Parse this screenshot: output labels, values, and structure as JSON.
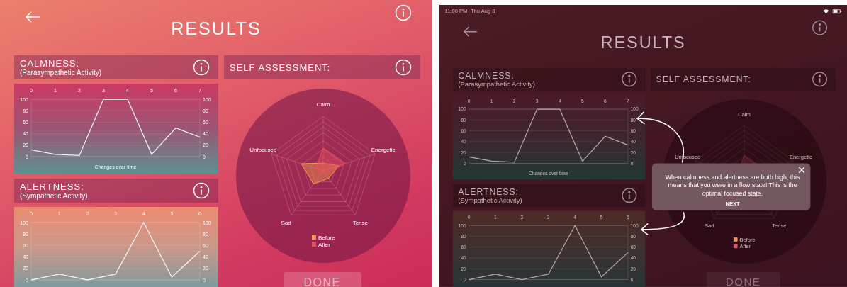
{
  "screens": [
    {
      "dimmed": false,
      "title": "RESULTS",
      "left_panels": [
        {
          "title": "CALMNESS:",
          "subtitle": "(Parasympathetic Activity)",
          "chart_data": {
            "type": "line",
            "xlabel": "Changes over time",
            "categories": [
              "0",
              "1",
              "2",
              "3",
              "4",
              "5",
              "6",
              "7"
            ],
            "values": [
              12,
              4,
              2,
              100,
              100,
              4,
              50,
              34
            ],
            "ylim": [
              0,
              100
            ],
            "yticks": [
              0,
              20,
              40,
              60,
              80,
              100
            ],
            "y2lim": [
              0,
              100
            ],
            "y2ticks": [
              0,
              20,
              40,
              60,
              80,
              100
            ],
            "grid": true
          }
        },
        {
          "title": "ALERTNESS:",
          "subtitle": "(Sympathetic Activity)",
          "chart_data": {
            "type": "line",
            "categories": [
              "0",
              "1",
              "2",
              "3",
              "4",
              "5",
              "6"
            ],
            "values": [
              0,
              10,
              0,
              10,
              100,
              5,
              50
            ],
            "ylim": [
              0,
              100
            ],
            "yticks": [
              0,
              20,
              40,
              60,
              80,
              100
            ],
            "y2lim": [
              0,
              100
            ],
            "y2ticks": [
              0,
              20,
              40,
              60,
              80,
              100
            ],
            "grid": true
          }
        }
      ],
      "self_assessment": {
        "title": "SELF ASSESSMENT:",
        "axes": [
          "Calm",
          "Energetic",
          "Tense",
          "Sad",
          "Unfocused"
        ],
        "legend": [
          {
            "label": "Before",
            "color": "#f29a4e"
          },
          {
            "label": "After",
            "color": "#ea4f5e"
          }
        ]
      },
      "done_button": "DONE"
    },
    {
      "dimmed": true,
      "status_bar": {
        "time": "11:00 PM",
        "date": "Thu Aug 8"
      },
      "title": "RESULTS",
      "left_panels": [
        {
          "title": "CALMNESS:",
          "subtitle": "(Parasympathetic Activity)",
          "chart_data": {
            "type": "line",
            "xlabel": "Changes over time",
            "categories": [
              "0",
              "1",
              "2",
              "3",
              "4",
              "5",
              "6",
              "7"
            ],
            "values": [
              12,
              4,
              2,
              100,
              100,
              4,
              50,
              34
            ],
            "ylim": [
              0,
              100
            ],
            "yticks": [
              0,
              20,
              40,
              60,
              80,
              100
            ],
            "y2lim": [
              0,
              100
            ],
            "y2ticks": [
              0,
              20,
              40,
              60,
              80,
              100
            ],
            "grid": true
          }
        },
        {
          "title": "ALERTNESS:",
          "subtitle": "(Sympathetic Activity)",
          "chart_data": {
            "type": "line",
            "categories": [
              "0",
              "1",
              "2",
              "3",
              "4",
              "5",
              "6"
            ],
            "values": [
              0,
              10,
              0,
              10,
              100,
              5,
              50
            ],
            "ylim": [
              0,
              100
            ],
            "yticks": [
              0,
              20,
              40,
              60,
              80,
              100
            ],
            "y2lim": [
              0,
              100
            ],
            "y2ticks": [
              0,
              20,
              40,
              60,
              80,
              100
            ],
            "grid": true
          }
        }
      ],
      "self_assessment": {
        "title": "SELF ASSESSMENT:",
        "axes": [
          "Calm",
          "Energetic",
          "Tense",
          "Sad",
          "Unfocused"
        ],
        "legend": [
          {
            "label": "Before",
            "color": "#f29a4e"
          },
          {
            "label": "After",
            "color": "#ea4f5e"
          }
        ]
      },
      "done_button": "DONE",
      "tooltip": {
        "text": "When calmness and alertness are both high, this means that you were in a flow state! This is the optimal focused state.",
        "next": "NEXT"
      }
    }
  ]
}
